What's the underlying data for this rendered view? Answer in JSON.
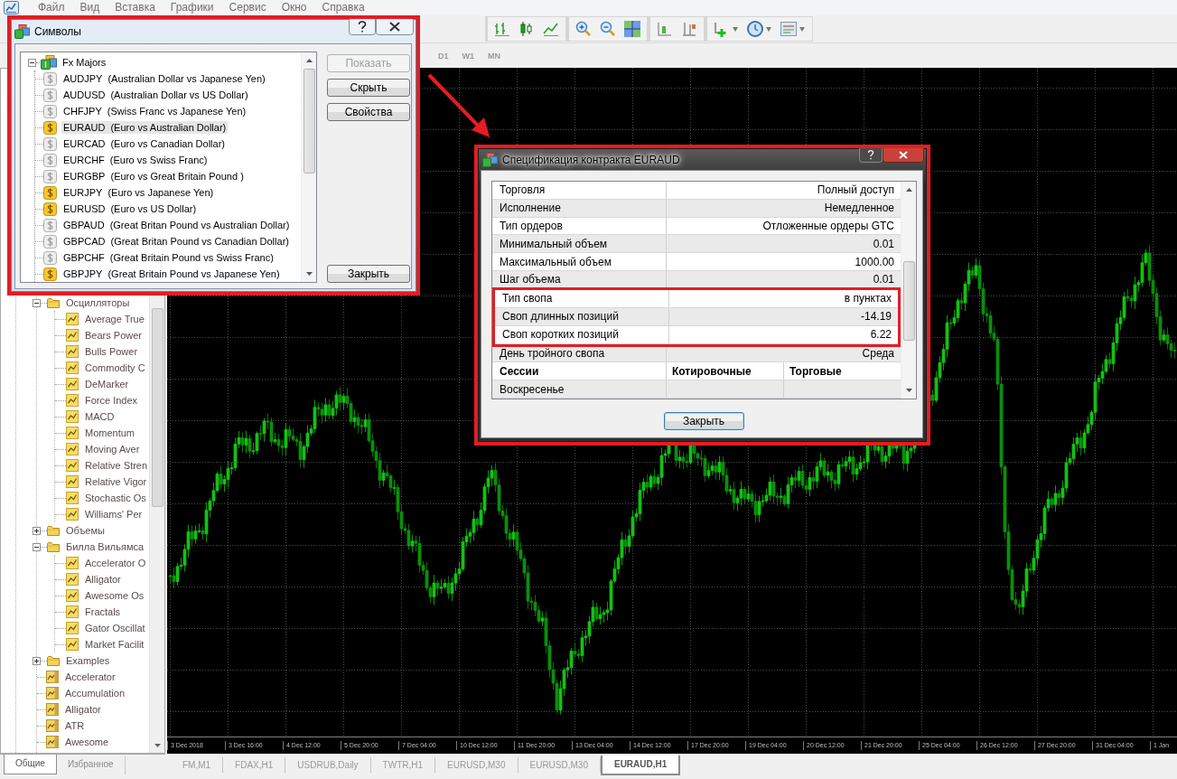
{
  "menu": [
    "Файл",
    "Вид",
    "Вставка",
    "Графики",
    "Сервис",
    "Окно",
    "Справка"
  ],
  "timeframes": [
    "D1",
    "W1",
    "MN"
  ],
  "navigator": {
    "items": [
      {
        "kind": "folder",
        "label": "Осцилляторы",
        "expanded": true,
        "children": [
          {
            "kind": "indicator",
            "label": "Average True"
          },
          {
            "kind": "indicator",
            "label": "Bears Power"
          },
          {
            "kind": "indicator",
            "label": "Bulls Power"
          },
          {
            "kind": "indicator",
            "label": "Commodity C"
          },
          {
            "kind": "indicator",
            "label": "DeMarker"
          },
          {
            "kind": "indicator",
            "label": "Force Index"
          },
          {
            "kind": "indicator",
            "label": "MACD"
          },
          {
            "kind": "indicator",
            "label": "Momentum"
          },
          {
            "kind": "indicator",
            "label": "Moving Aver"
          },
          {
            "kind": "indicator",
            "label": "Relative Stren"
          },
          {
            "kind": "indicator",
            "label": "Relative Vigor"
          },
          {
            "kind": "indicator",
            "label": "Stochastic Os"
          },
          {
            "kind": "indicator",
            "label": "Williams' Per"
          }
        ]
      },
      {
        "kind": "folder",
        "label": "Объемы",
        "expanded": false
      },
      {
        "kind": "folder",
        "label": "Билла Вильямса",
        "expanded": true,
        "children": [
          {
            "kind": "indicator",
            "label": "Accelerator O"
          },
          {
            "kind": "indicator",
            "label": "Alligator"
          },
          {
            "kind": "indicator",
            "label": "Awesome Os"
          },
          {
            "kind": "indicator",
            "label": "Fractals"
          },
          {
            "kind": "indicator",
            "label": "Gator Oscillat"
          },
          {
            "kind": "indicator",
            "label": "Market Facilit"
          }
        ]
      },
      {
        "kind": "folder",
        "label": "Examples",
        "expanded": false
      },
      {
        "kind": "custom",
        "label": "Accelerator"
      },
      {
        "kind": "custom",
        "label": "Accumulation"
      },
      {
        "kind": "custom",
        "label": "Alligator"
      },
      {
        "kind": "custom",
        "label": "ATR"
      },
      {
        "kind": "custom",
        "label": "Awesome"
      }
    ],
    "tabs": [
      {
        "label": "Общие",
        "selected": true
      },
      {
        "label": "Избранное",
        "selected": false
      }
    ]
  },
  "chart": {
    "time_axis": [
      "3 Dec 2018",
      "3 Dec 16:00",
      "4 Dec 12:00",
      "5 Dec 20:00",
      "7 Dec 04:00",
      "10 Dec 12:00",
      "11 Dec 20:00",
      "13 Dec 04:00",
      "14 Dec 12:00",
      "17 Dec 20:00",
      "19 Dec 04:00",
      "20 Dec 12:00",
      "21 Dec 20:00",
      "25 Dec 04:00",
      "26 Dec 12:00",
      "27 Dec 20:00",
      "31 Dec 04:00",
      "1 Jan"
    ]
  },
  "chart_tabs": [
    {
      "label": "FM,M1",
      "selected": false
    },
    {
      "label": "FDAX,H1",
      "selected": false
    },
    {
      "label": "USDRUB,Daily",
      "selected": false
    },
    {
      "label": "TWTR,H1",
      "selected": false
    },
    {
      "label": "EURUSD,M30",
      "selected": false
    },
    {
      "label": "EURUSD,M30",
      "selected": false
    },
    {
      "label": "EURAUD,H1",
      "selected": true
    }
  ],
  "symbols_dialog": {
    "title": "Символы",
    "highlighted": true,
    "tree": {
      "label": "Fx Majors",
      "expanded": true,
      "children": [
        {
          "symbol": "AUDJPY",
          "description": "(Australian Dollar vs Japanese Yen)",
          "shown": false,
          "selected": false
        },
        {
          "symbol": "AUDUSD",
          "description": "(Australian Dollar vs US Dollar)",
          "shown": false,
          "selected": false
        },
        {
          "symbol": "CHFJPY",
          "description": "(Swiss Franc vs Japanese Yen)",
          "shown": false,
          "selected": false
        },
        {
          "symbol": "EURAUD",
          "description": "(Euro vs Australian Dollar)",
          "shown": true,
          "selected": true
        },
        {
          "symbol": "EURCAD",
          "description": "(Euro vs Canadian Dollar)",
          "shown": false,
          "selected": false
        },
        {
          "symbol": "EURCHF",
          "description": "(Euro vs Swiss Franc)",
          "shown": false,
          "selected": false
        },
        {
          "symbol": "EURGBP",
          "description": "(Euro vs Great Britain Pound )",
          "shown": false,
          "selected": false
        },
        {
          "symbol": "EURJPY",
          "description": "(Euro vs Japanese Yen)",
          "shown": true,
          "selected": false
        },
        {
          "symbol": "EURUSD",
          "description": "(Euro vs US Dollar)",
          "shown": true,
          "selected": false
        },
        {
          "symbol": "GBPAUD",
          "description": "(Great Britan Pound vs Australian Dollar)",
          "shown": false,
          "selected": false
        },
        {
          "symbol": "GBPCAD",
          "description": "(Great Britan Pound vs Canadian Dollar)",
          "shown": false,
          "selected": false
        },
        {
          "symbol": "GBPCHF",
          "description": "(Great Britain Pound vs Swiss Franc)",
          "shown": false,
          "selected": false
        },
        {
          "symbol": "GBPJPY",
          "description": "(Great Britain Pound vs Japanese Yen)",
          "shown": true,
          "selected": false
        }
      ]
    },
    "buttons": [
      {
        "label": "Показать",
        "disabled": true
      },
      {
        "label": "Скрыть",
        "disabled": false
      },
      {
        "label": "Свойства",
        "disabled": false
      },
      {
        "label": "Закрыть",
        "disabled": false
      }
    ]
  },
  "spec_dialog": {
    "title": "Спецификация контракта EURAUD",
    "highlighted": true,
    "rows": [
      {
        "kind": "field",
        "label": "Торговля",
        "value": "Полный доступ",
        "highlighted": false
      },
      {
        "kind": "field",
        "label": "Исполнение",
        "value": "Немедленное",
        "highlighted": false
      },
      {
        "kind": "field",
        "label": "Тип ордеров",
        "value": "Отложенные ордеры GTC",
        "highlighted": false
      },
      {
        "kind": "field",
        "label": "Минимальный объем",
        "value": "0.01",
        "highlighted": false
      },
      {
        "kind": "field",
        "label": "Максимальный объем",
        "value": "1000.00",
        "highlighted": false
      },
      {
        "kind": "field",
        "label": "Шаг объема",
        "value": "0.01",
        "highlighted": false
      },
      {
        "kind": "field",
        "label": "Тип свопа",
        "value": "в пунктах",
        "highlighted": true
      },
      {
        "kind": "field",
        "label": "Своп длинных позиций",
        "value": "-14.19",
        "highlighted": true
      },
      {
        "kind": "field",
        "label": "Своп коротких позиций",
        "value": "6.22",
        "highlighted": true
      },
      {
        "kind": "field",
        "label": "День тройного свопа",
        "value": "Среда",
        "highlighted": false
      },
      {
        "kind": "header",
        "cells": [
          "Сессии",
          "Котировочные",
          "Торговые"
        ],
        "highlighted": false
      },
      {
        "kind": "session",
        "label": "Воскресенье",
        "highlighted": false
      }
    ],
    "button": "Закрыть"
  }
}
